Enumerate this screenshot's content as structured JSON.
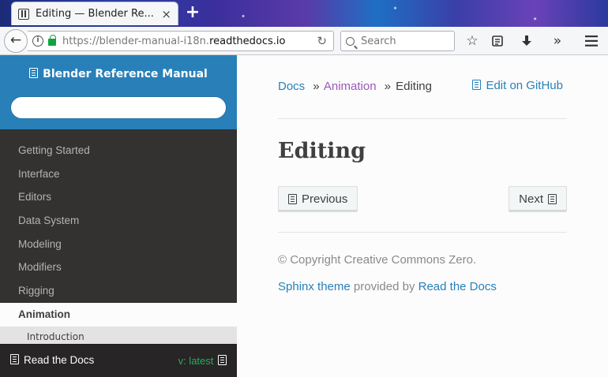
{
  "browser": {
    "tab_title": "Editing — Blender Re...",
    "tab_close": "×",
    "new_tab": "+",
    "url_prefix": "https://blender-manual-i18n.",
    "url_domain": "readthedocs.io",
    "search_placeholder": "Search",
    "icons": [
      "back-arrow-icon",
      "info-icon",
      "lock-icon",
      "reload-icon",
      "search-icon",
      "bookmark-star-icon",
      "reading-list-icon",
      "download-icon",
      "overflow-icon",
      "hamburger-menu-icon"
    ]
  },
  "sidebar": {
    "title": "Blender Reference Manual",
    "search_value": "",
    "items": [
      {
        "label": "Getting Started"
      },
      {
        "label": "Interface"
      },
      {
        "label": "Editors"
      },
      {
        "label": "Data System"
      },
      {
        "label": "Modeling"
      },
      {
        "label": "Modifiers"
      },
      {
        "label": "Rigging"
      },
      {
        "label": "Animation"
      }
    ],
    "current_index": 7,
    "sub_item_partial": "Introduction",
    "footer": {
      "label": "Read the Docs",
      "version": "v: latest"
    }
  },
  "content": {
    "breadcrumb": [
      {
        "label": "Docs"
      },
      {
        "label": "Animation"
      },
      {
        "label": "Editing"
      }
    ],
    "breadcrumb_sep": "»",
    "edit_link": "Edit on GitHub",
    "title": "Editing",
    "prev_button": "Previous",
    "next_button": "Next",
    "copyright": "© Copyright Creative Commons Zero.",
    "credits": {
      "theme_link": "Sphinx theme",
      "middle": " provided by ",
      "rtd_link": "Read the Docs"
    }
  },
  "colors": {
    "sidebar_header": "#2980b9",
    "sidebar_bg": "#343131",
    "link": "#2980b9",
    "visited_link": "#9b59b6",
    "version": "#27ae60"
  }
}
